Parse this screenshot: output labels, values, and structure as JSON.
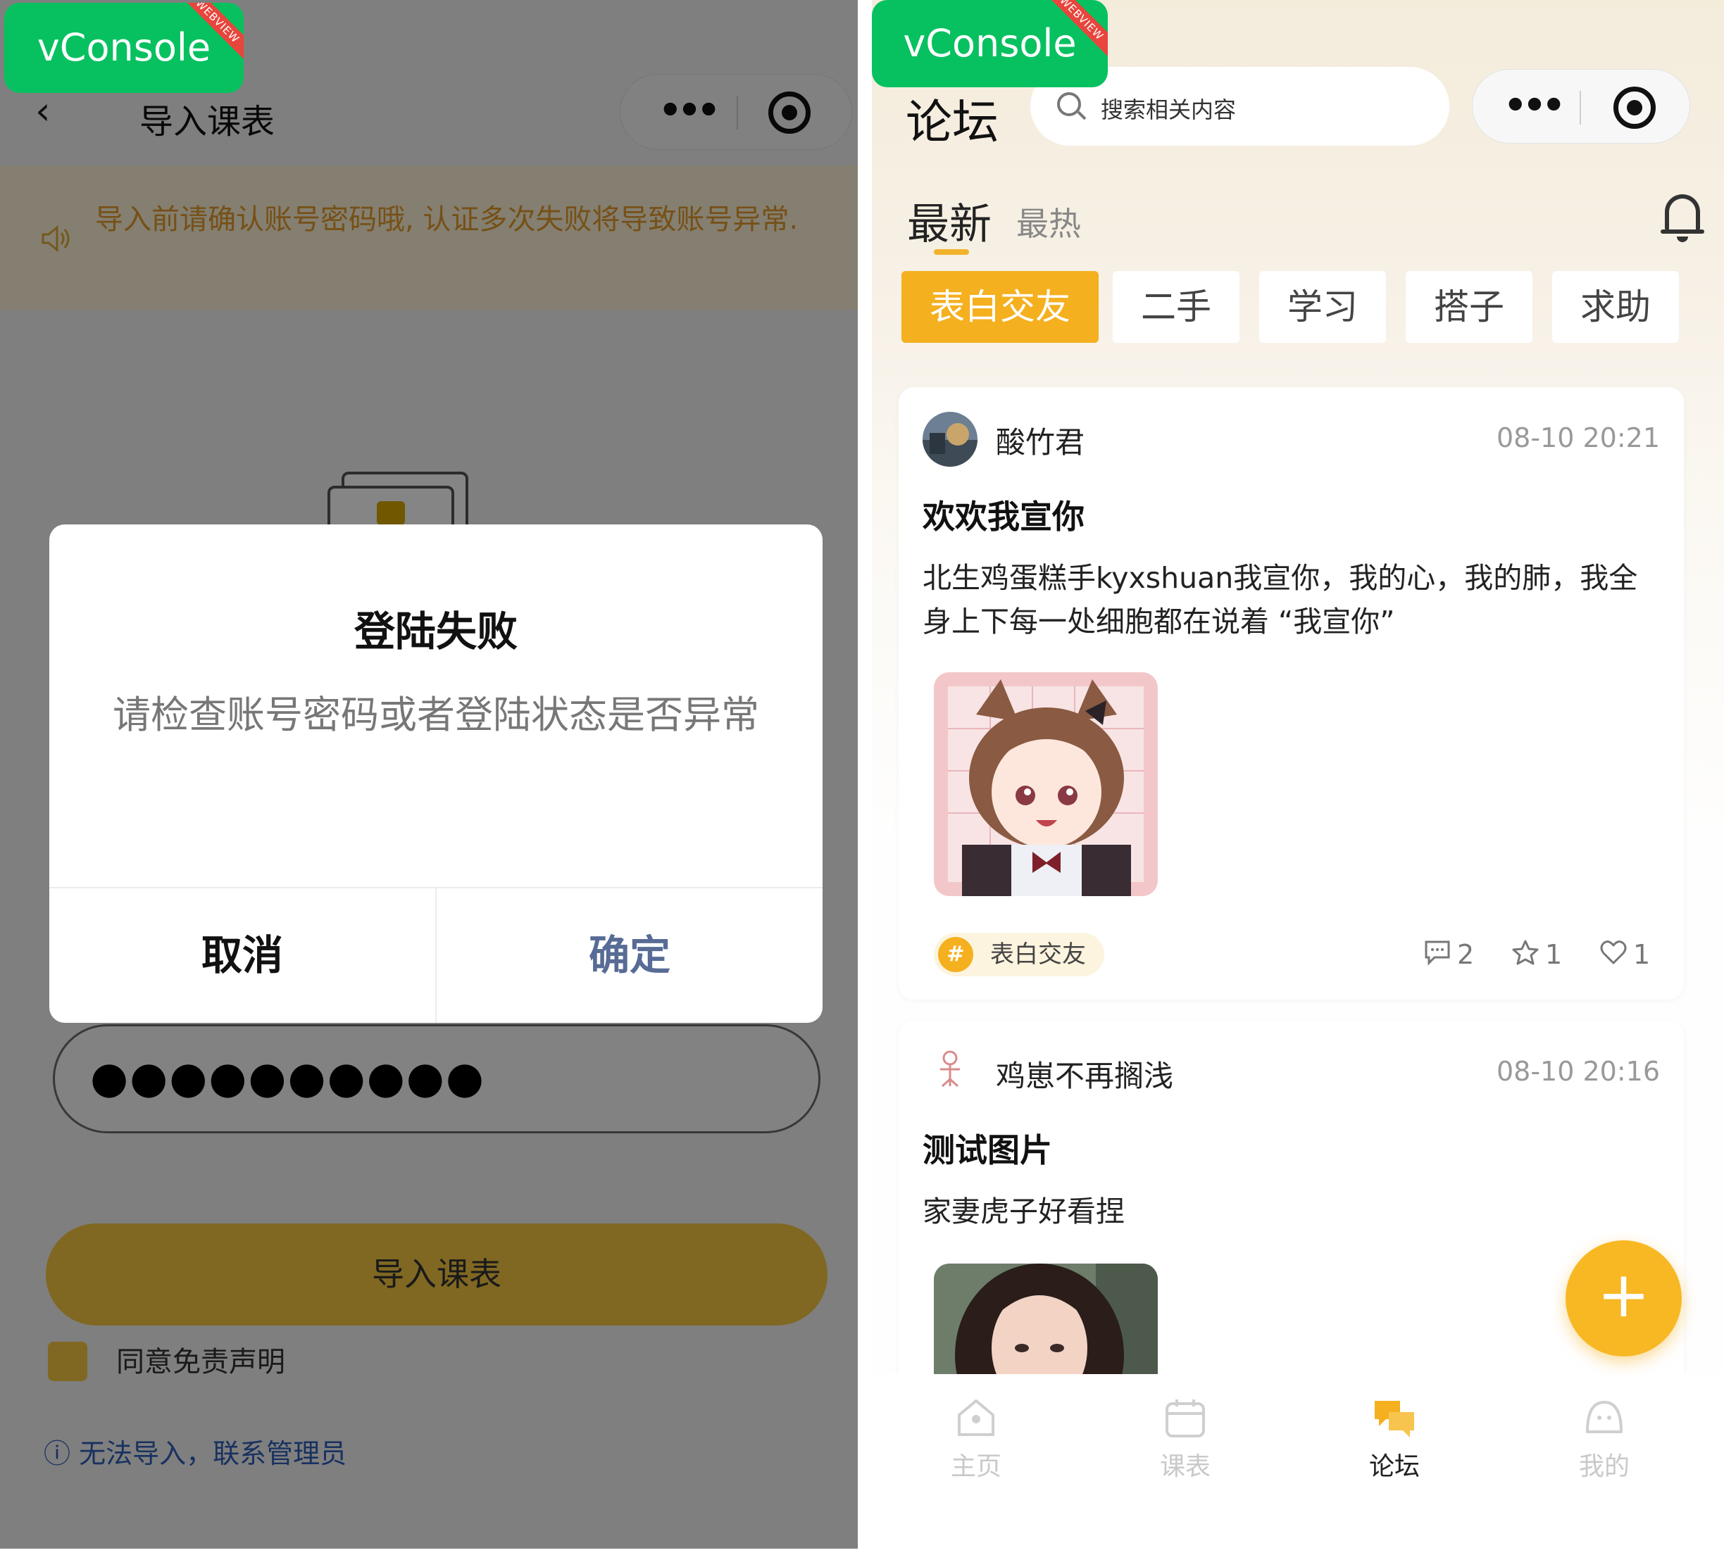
{
  "left_screen": {
    "vconsole": {
      "label": "vConsole",
      "ribbon": "WEBVIEW"
    },
    "nav": {
      "title": "导入课表",
      "back_icon": "chevron-left-icon",
      "menu_icon": "more-dots-icon",
      "close_icon": "target-circle-icon"
    },
    "notice": {
      "icon": "speaker-icon",
      "text": "导入前请确认账号密码哦, 认证多次失败将导致账号异常."
    },
    "password_field": {
      "value": "●●●●●●●●●●"
    },
    "import_button": {
      "label": "导入课表"
    },
    "agree": {
      "label": "同意免责声明"
    },
    "help": {
      "label": "ⓘ 无法导入，联系管理员"
    },
    "modal": {
      "title": "登陆失败",
      "message": "请检查账号密码或者登陆状态是否异常",
      "cancel_label": "取消",
      "confirm_label": "确定"
    },
    "colors": {
      "accent": "#f5c842",
      "link": "#2f5fb8",
      "notice_text": "#e39a2c",
      "confirm": "#576b95"
    }
  },
  "right_screen": {
    "vconsole": {
      "label": "vConsole",
      "ribbon": "WEBVIEW"
    },
    "header": {
      "title": "论坛",
      "search_placeholder": "搜索相关内容"
    },
    "sort_tabs": {
      "latest": "最新",
      "hot": "最热",
      "active": "最新"
    },
    "categories": [
      "表白交友",
      "二手",
      "学习",
      "搭子",
      "求助"
    ],
    "active_category": "表白交友",
    "posts": [
      {
        "username": "酸竹君",
        "time": "08-10 20:21",
        "title": "欢欢我宣你",
        "body": "北生鸡蛋糕手kyxshuan我宣你，我的心，我的肺，我全身上下每一处细胞都在说着 “我宣你”",
        "tag": "表白交友",
        "comments": "2",
        "stars": "1",
        "likes": "1"
      },
      {
        "username": "鸡崽不再搁浅",
        "time": "08-10 20:16",
        "title": "测试图片",
        "body": "家妻虎子好看捏"
      }
    ],
    "fab_icon": "plus-icon",
    "tabbar": [
      {
        "label": "主页",
        "icon": "home-icon"
      },
      {
        "label": "课表",
        "icon": "calendar-icon"
      },
      {
        "label": "论坛",
        "icon": "forum-icon"
      },
      {
        "label": "我的",
        "icon": "profile-icon"
      }
    ],
    "active_tab": "论坛",
    "colors": {
      "accent": "#f5b01f",
      "background": "#f4ecdb"
    }
  }
}
